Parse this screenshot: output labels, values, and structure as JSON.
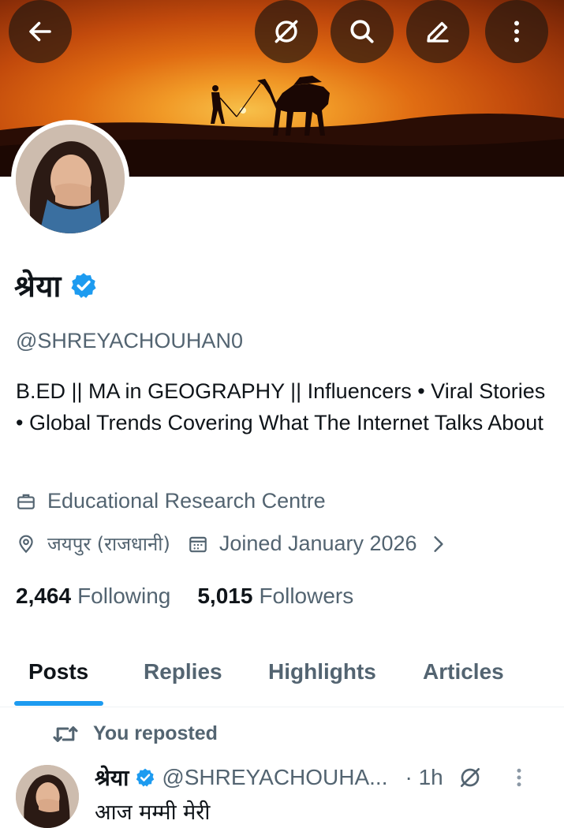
{
  "header": {
    "back": "back-arrow-icon",
    "actions": [
      "grok-icon",
      "search-icon",
      "edit-icon",
      "more-vertical-icon"
    ]
  },
  "profile": {
    "name": "श्रेया",
    "handle": "@SHREYACHOUHAN0",
    "bio": "B.ED || MA in GEOGRAPHY || Influencers • Viral Stories • Global Trends Covering What The Internet Talks About",
    "category": "Educational Research Centre",
    "location": "जयपुर (राजधानी)",
    "joined": "Joined January 2026",
    "following_count": "2,464",
    "following_label": "Following",
    "followers_count": "5,015",
    "followers_label": "Followers"
  },
  "tabs": [
    {
      "label": "Posts",
      "active": true
    },
    {
      "label": "Replies",
      "active": false
    },
    {
      "label": "Highlights",
      "active": false
    },
    {
      "label": "Articles",
      "active": false
    }
  ],
  "feed": {
    "repost_label": "You reposted",
    "tweet": {
      "name": "श्रेया",
      "handle": "@SHREYACHOUHA...",
      "time": "· 1h",
      "text": "आज मम्मी मेरी"
    }
  },
  "colors": {
    "accent": "#1d9bf0",
    "text": "#0f1419",
    "muted": "#536471"
  }
}
